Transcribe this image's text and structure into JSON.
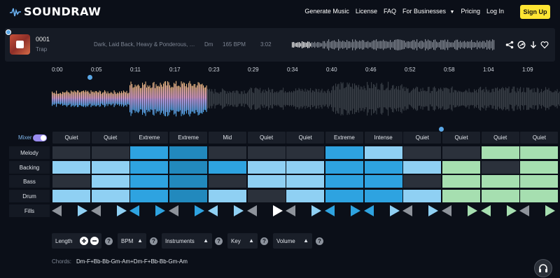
{
  "nav": {
    "logo": "SOUNDRAW",
    "links": [
      "Generate Music",
      "License",
      "FAQ",
      "For Businesses",
      "Pricing",
      "Log In"
    ],
    "signup": "Sign Up"
  },
  "track": {
    "number": "0001",
    "genre": "Trap",
    "mood": "Dark, Laid Back, Heavy & Ponderous, S...",
    "key": "Dm",
    "bpm": "165 BPM",
    "duration": "3:02",
    "icons": [
      "share-icon",
      "shuffle-icon",
      "download-icon",
      "heart-icon"
    ]
  },
  "timeline": [
    "0:00",
    "0:05",
    "0:11",
    "0:17",
    "0:23",
    "0:29",
    "0:34",
    "0:40",
    "0:46",
    "0:52",
    "0:58",
    "1:04",
    "1:09"
  ],
  "mixer": {
    "label": "Mixer",
    "energy": [
      "Quiet",
      "Quiet",
      "Extreme",
      "Extreme",
      "Mid",
      "Quiet",
      "Quiet",
      "Extreme",
      "Intense",
      "Quiet",
      "Quiet",
      "Quiet",
      "Quiet"
    ],
    "tracks": [
      {
        "name": "Melody",
        "levels": [
          "dark",
          "dark",
          "blue",
          "blue-sel",
          "dark",
          "dark",
          "dark",
          "blue",
          "light",
          "dark",
          "dark",
          "green",
          "green"
        ]
      },
      {
        "name": "Backing",
        "levels": [
          "light",
          "light",
          "blue",
          "blue-sel",
          "blue",
          "light",
          "light",
          "blue",
          "blue",
          "light",
          "green",
          "dark",
          "green"
        ]
      },
      {
        "name": "Bass",
        "levels": [
          "dark",
          "light",
          "blue",
          "blue-sel",
          "dark",
          "light",
          "light",
          "blue",
          "blue",
          "dark",
          "green",
          "green",
          "green"
        ]
      },
      {
        "name": "Drum",
        "levels": [
          "light",
          "light",
          "blue",
          "blue-sel",
          "light",
          "dark",
          "light",
          "blue",
          "blue",
          "light",
          "green",
          "green",
          "green"
        ]
      }
    ],
    "fills_label": "Fills"
  },
  "controls": {
    "length": "Length",
    "bpm": "BPM",
    "instruments": "Instruments",
    "key": "Key",
    "volume": "Volume"
  },
  "chords": {
    "label": "Chords:",
    "value": "Dm-F+Bb-Bb-Gm-Am+Dm-F+Bb-Bb-Gm-Am"
  },
  "colors": {
    "accent": "#ffe533",
    "blue": "#2ea3e0",
    "light_blue": "#8fd0f3",
    "green": "#a6dfb0",
    "dark_cell": "#2b313b"
  }
}
